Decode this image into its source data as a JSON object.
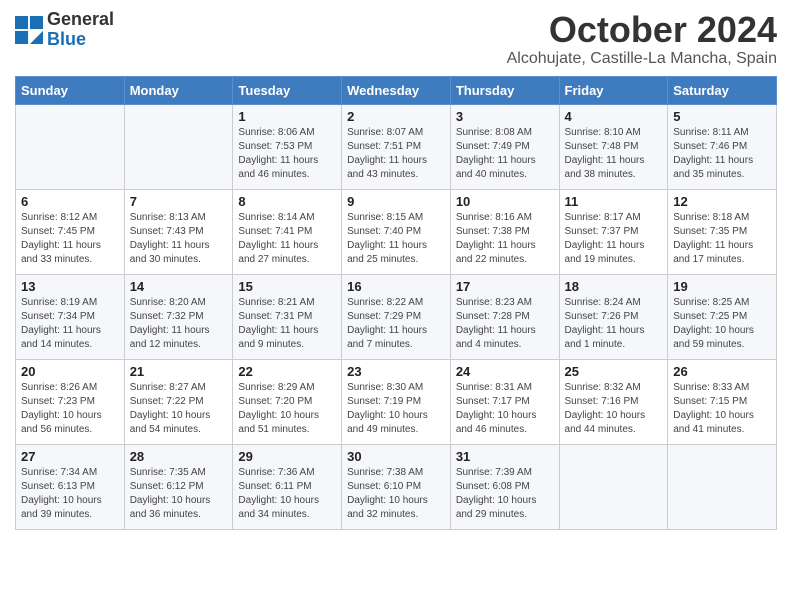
{
  "logo": {
    "general": "General",
    "blue": "Blue"
  },
  "title": {
    "month_year": "October 2024",
    "location": "Alcohujate, Castille-La Mancha, Spain"
  },
  "days_of_week": [
    "Sunday",
    "Monday",
    "Tuesday",
    "Wednesday",
    "Thursday",
    "Friday",
    "Saturday"
  ],
  "weeks": [
    [
      {
        "day": "",
        "info": ""
      },
      {
        "day": "",
        "info": ""
      },
      {
        "day": "1",
        "info": "Sunrise: 8:06 AM\nSunset: 7:53 PM\nDaylight: 11 hours and 46 minutes."
      },
      {
        "day": "2",
        "info": "Sunrise: 8:07 AM\nSunset: 7:51 PM\nDaylight: 11 hours and 43 minutes."
      },
      {
        "day": "3",
        "info": "Sunrise: 8:08 AM\nSunset: 7:49 PM\nDaylight: 11 hours and 40 minutes."
      },
      {
        "day": "4",
        "info": "Sunrise: 8:10 AM\nSunset: 7:48 PM\nDaylight: 11 hours and 38 minutes."
      },
      {
        "day": "5",
        "info": "Sunrise: 8:11 AM\nSunset: 7:46 PM\nDaylight: 11 hours and 35 minutes."
      }
    ],
    [
      {
        "day": "6",
        "info": "Sunrise: 8:12 AM\nSunset: 7:45 PM\nDaylight: 11 hours and 33 minutes."
      },
      {
        "day": "7",
        "info": "Sunrise: 8:13 AM\nSunset: 7:43 PM\nDaylight: 11 hours and 30 minutes."
      },
      {
        "day": "8",
        "info": "Sunrise: 8:14 AM\nSunset: 7:41 PM\nDaylight: 11 hours and 27 minutes."
      },
      {
        "day": "9",
        "info": "Sunrise: 8:15 AM\nSunset: 7:40 PM\nDaylight: 11 hours and 25 minutes."
      },
      {
        "day": "10",
        "info": "Sunrise: 8:16 AM\nSunset: 7:38 PM\nDaylight: 11 hours and 22 minutes."
      },
      {
        "day": "11",
        "info": "Sunrise: 8:17 AM\nSunset: 7:37 PM\nDaylight: 11 hours and 19 minutes."
      },
      {
        "day": "12",
        "info": "Sunrise: 8:18 AM\nSunset: 7:35 PM\nDaylight: 11 hours and 17 minutes."
      }
    ],
    [
      {
        "day": "13",
        "info": "Sunrise: 8:19 AM\nSunset: 7:34 PM\nDaylight: 11 hours and 14 minutes."
      },
      {
        "day": "14",
        "info": "Sunrise: 8:20 AM\nSunset: 7:32 PM\nDaylight: 11 hours and 12 minutes."
      },
      {
        "day": "15",
        "info": "Sunrise: 8:21 AM\nSunset: 7:31 PM\nDaylight: 11 hours and 9 minutes."
      },
      {
        "day": "16",
        "info": "Sunrise: 8:22 AM\nSunset: 7:29 PM\nDaylight: 11 hours and 7 minutes."
      },
      {
        "day": "17",
        "info": "Sunrise: 8:23 AM\nSunset: 7:28 PM\nDaylight: 11 hours and 4 minutes."
      },
      {
        "day": "18",
        "info": "Sunrise: 8:24 AM\nSunset: 7:26 PM\nDaylight: 11 hours and 1 minute."
      },
      {
        "day": "19",
        "info": "Sunrise: 8:25 AM\nSunset: 7:25 PM\nDaylight: 10 hours and 59 minutes."
      }
    ],
    [
      {
        "day": "20",
        "info": "Sunrise: 8:26 AM\nSunset: 7:23 PM\nDaylight: 10 hours and 56 minutes."
      },
      {
        "day": "21",
        "info": "Sunrise: 8:27 AM\nSunset: 7:22 PM\nDaylight: 10 hours and 54 minutes."
      },
      {
        "day": "22",
        "info": "Sunrise: 8:29 AM\nSunset: 7:20 PM\nDaylight: 10 hours and 51 minutes."
      },
      {
        "day": "23",
        "info": "Sunrise: 8:30 AM\nSunset: 7:19 PM\nDaylight: 10 hours and 49 minutes."
      },
      {
        "day": "24",
        "info": "Sunrise: 8:31 AM\nSunset: 7:17 PM\nDaylight: 10 hours and 46 minutes."
      },
      {
        "day": "25",
        "info": "Sunrise: 8:32 AM\nSunset: 7:16 PM\nDaylight: 10 hours and 44 minutes."
      },
      {
        "day": "26",
        "info": "Sunrise: 8:33 AM\nSunset: 7:15 PM\nDaylight: 10 hours and 41 minutes."
      }
    ],
    [
      {
        "day": "27",
        "info": "Sunrise: 7:34 AM\nSunset: 6:13 PM\nDaylight: 10 hours and 39 minutes."
      },
      {
        "day": "28",
        "info": "Sunrise: 7:35 AM\nSunset: 6:12 PM\nDaylight: 10 hours and 36 minutes."
      },
      {
        "day": "29",
        "info": "Sunrise: 7:36 AM\nSunset: 6:11 PM\nDaylight: 10 hours and 34 minutes."
      },
      {
        "day": "30",
        "info": "Sunrise: 7:38 AM\nSunset: 6:10 PM\nDaylight: 10 hours and 32 minutes."
      },
      {
        "day": "31",
        "info": "Sunrise: 7:39 AM\nSunset: 6:08 PM\nDaylight: 10 hours and 29 minutes."
      },
      {
        "day": "",
        "info": ""
      },
      {
        "day": "",
        "info": ""
      }
    ]
  ]
}
